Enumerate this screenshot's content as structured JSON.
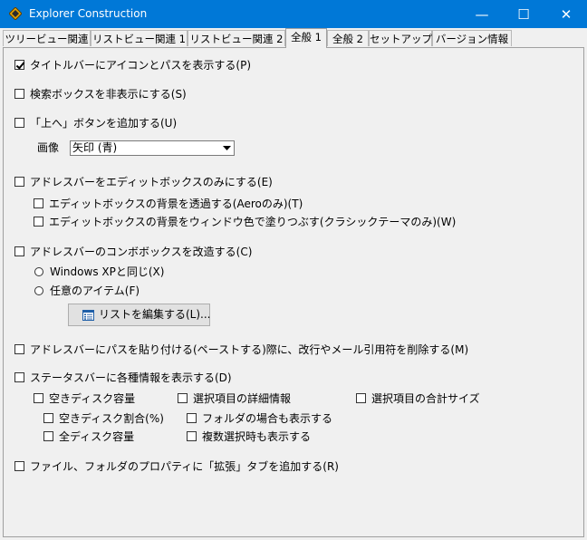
{
  "window": {
    "title": "Explorer Construction",
    "minimize_glyph": "—",
    "maximize_glyph": "☐",
    "close_glyph": "✕"
  },
  "tabs": [
    {
      "label": "ツリービュー関連",
      "active": false
    },
    {
      "label": "リストビュー関連 1",
      "active": false
    },
    {
      "label": "リストビュー関連 2",
      "active": false
    },
    {
      "label": "全般 1",
      "active": true
    },
    {
      "label": "全般 2",
      "active": false
    },
    {
      "label": "セットアップ",
      "active": false
    },
    {
      "label": "バージョン情報",
      "active": false
    }
  ],
  "options": {
    "titlebar_path": {
      "label": "タイトルバーにアイコンとパスを表示する(P)",
      "checked": true
    },
    "hide_search": {
      "label": "検索ボックスを非表示にする(S)",
      "checked": false
    },
    "add_up_button": {
      "label": "「上へ」ボタンを追加する(U)",
      "checked": false
    },
    "image_label": "画像",
    "image_value": "矢印 (青)",
    "address_edit_only": {
      "label": "アドレスバーをエディットボックスのみにする(E)",
      "checked": false
    },
    "edit_transparent": {
      "label": "エディットボックスの背景を透過する(Aeroのみ)(T)",
      "checked": false
    },
    "edit_window_color": {
      "label": "エディットボックスの背景をウィンドウ色で塗りつぶす(クラシックテーマのみ)(W)",
      "checked": false
    },
    "address_combo": {
      "label": "アドレスバーのコンボボックスを改造する(C)",
      "checked": false
    },
    "radio_xp": {
      "label": "Windows XPと同じ(X)",
      "selected": false
    },
    "radio_custom": {
      "label": "任意のアイテム(F)",
      "selected": false
    },
    "edit_list_button": "リストを編集する(L)...",
    "paste_strip": {
      "label": "アドレスバーにパスを貼り付ける(ペーストする)際に、改行やメール引用符を削除する(M)",
      "checked": false
    },
    "status_info": {
      "label": "ステータスバーに各種情報を表示する(D)",
      "checked": false
    },
    "free_space": {
      "label": "空きディスク容量",
      "checked": false
    },
    "free_ratio": {
      "label": "空きディスク割合(%)",
      "checked": false
    },
    "total_space": {
      "label": "全ディスク容量",
      "checked": false
    },
    "selected_details": {
      "label": "選択項目の詳細情報",
      "checked": false
    },
    "show_folder": {
      "label": "フォルダの場合も表示する",
      "checked": false
    },
    "show_multi": {
      "label": "複数選択時も表示する",
      "checked": false
    },
    "selected_total": {
      "label": "選択項目の合計サイズ",
      "checked": false
    },
    "extended_tab": {
      "label": "ファイル、フォルダのプロパティに「拡張」タブを追加する(R)",
      "checked": false
    }
  }
}
